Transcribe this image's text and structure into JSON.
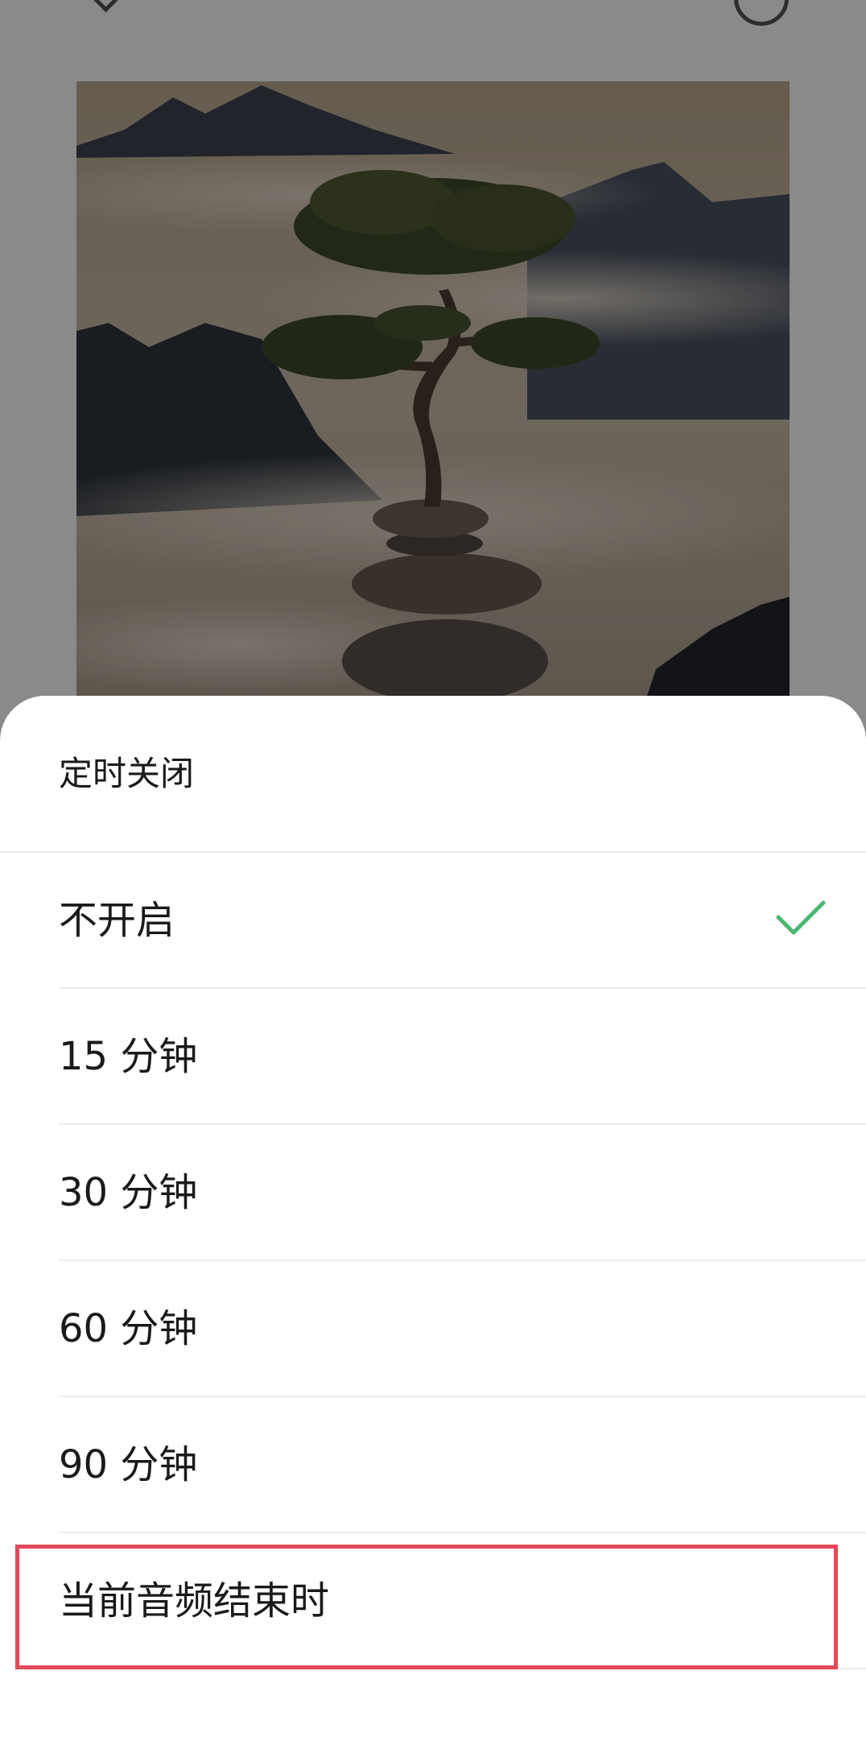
{
  "header": {
    "back_icon": "chevron-down-icon",
    "right_icon": "circle-icon"
  },
  "artwork": {
    "description_icon": "album-cover-image"
  },
  "sheet": {
    "title": "定时关闭",
    "options": [
      {
        "label": "不开启",
        "selected": true
      },
      {
        "label": "15 分钟",
        "selected": false
      },
      {
        "label": "30 分钟",
        "selected": false
      },
      {
        "label": "60 分钟",
        "selected": false
      },
      {
        "label": "90 分钟",
        "selected": false
      },
      {
        "label": "当前音频结束时",
        "selected": false
      }
    ],
    "check_color": "#4cb870",
    "highlight_color": "#e04a5a"
  }
}
